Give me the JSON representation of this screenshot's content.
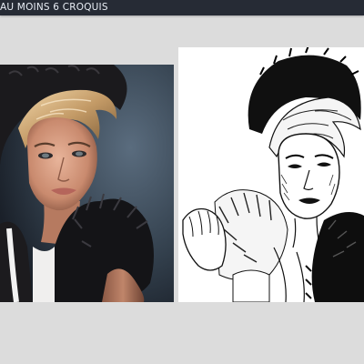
{
  "header": {
    "title": "AU MOINS 6 CROQUIS"
  },
  "colors": {
    "page_background": "#dcdcdc",
    "header_background": "#262b35",
    "header_text": "#e9eef5"
  },
  "images": {
    "photo": "color-photo-portrait",
    "sketch": "black-ink-sketch-portrait"
  }
}
